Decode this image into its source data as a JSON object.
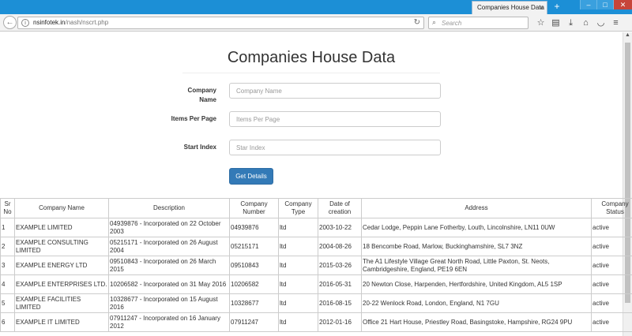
{
  "browser": {
    "tab_title": "Companies House Data",
    "tab_close": "×",
    "new_tab": "+",
    "url_domain": "nsinfotek.in",
    "url_path": "/nash/nscrt.php",
    "search_placeholder": "Search"
  },
  "page": {
    "title": "Companies House Data"
  },
  "form": {
    "company_name_label": "Company Name",
    "company_name_placeholder": "Company Name",
    "items_per_page_label": "Items Per Page",
    "items_per_page_placeholder": "Items Per Page",
    "start_index_label": "Start Index",
    "start_index_placeholder": "Star Index",
    "submit_label": "Get Details"
  },
  "table": {
    "headers": [
      "Sr No",
      "Company Name",
      "Description",
      "Company Number",
      "Company Type",
      "Date of creation",
      "Address",
      "Company Status"
    ],
    "rows": [
      [
        "1",
        "EXAMPLE LIMITED",
        "04939876 - Incorporated on 22 October 2003",
        "04939876",
        "ltd",
        "2003-10-22",
        "Cedar Lodge, Peppin Lane Fotherby, Louth, Lincolnshire, LN11 0UW",
        "active"
      ],
      [
        "2",
        "EXAMPLE CONSULTING LIMITED",
        "05215171 - Incorporated on 26 August 2004",
        "05215171",
        "ltd",
        "2004-08-26",
        "18 Bencombe Road, Marlow, Buckinghamshire, SL7 3NZ",
        "active"
      ],
      [
        "3",
        "EXAMPLE ENERGY LTD",
        "09510843 - Incorporated on 26 March 2015",
        "09510843",
        "ltd",
        "2015-03-26",
        "The A1 Lifestyle Village Great North Road, Little Paxton, St. Neots, Cambridgeshire, England, PE19 6EN",
        "active"
      ],
      [
        "4",
        "EXAMPLE ENTERPRISES LTD.",
        "10206582 - Incorporated on 31 May 2016",
        "10206582",
        "ltd",
        "2016-05-31",
        "20 Newton Close, Harpenden, Hertfordshire, United Kingdom, AL5 1SP",
        "active"
      ],
      [
        "5",
        "EXAMPLE FACILITIES LIMITED",
        "10328677 - Incorporated on 15 August 2016",
        "10328677",
        "ltd",
        "2016-08-15",
        "20-22 Wenlock Road, London, England, N1 7GU",
        "active"
      ],
      [
        "6",
        "EXAMPLE IT LIMITED",
        "07911247 - Incorporated on 16 January 2012",
        "07911247",
        "ltd",
        "2012-01-16",
        "Office 21 Hart House, Priestley Road, Basingstoke, Hampshire, RG24 9PU",
        "active"
      ]
    ]
  }
}
